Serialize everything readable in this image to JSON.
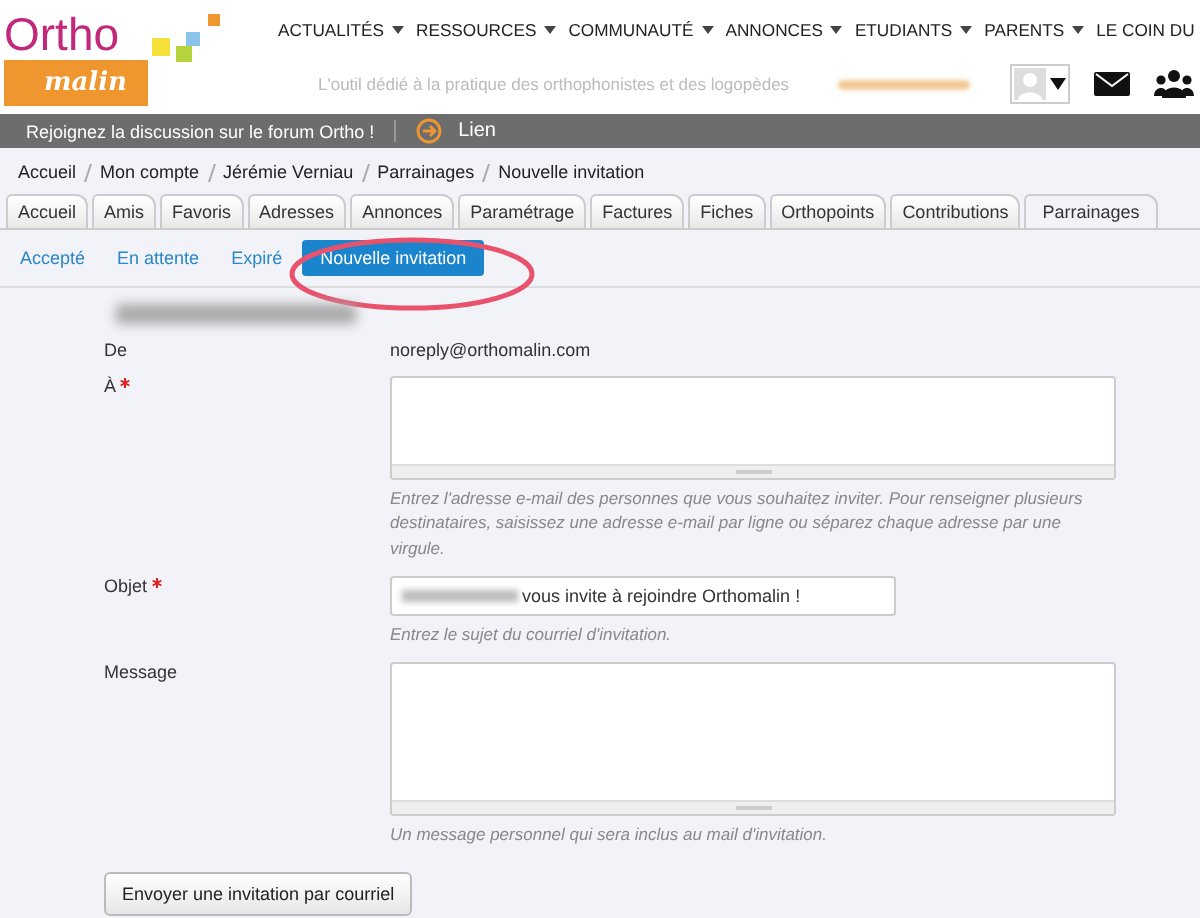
{
  "logo": {
    "top": "Ortho",
    "bottom": "malin"
  },
  "nav": [
    {
      "label": "ACTUALITÉS",
      "caret": true
    },
    {
      "label": "RESSOURCES",
      "caret": true
    },
    {
      "label": "COMMUNAUTÉ",
      "caret": true
    },
    {
      "label": "ANNONCES",
      "caret": true
    },
    {
      "label": "ETUDIANTS",
      "caret": true
    },
    {
      "label": "PARENTS",
      "caret": true
    },
    {
      "label": "LE COIN DU",
      "caret": false
    }
  ],
  "tagline": "L'outil dédié à la pratique des orthophonistes et des logopèdes",
  "banner": {
    "text": "Rejoignez la discussion sur le forum Ortho !",
    "link": "Lien"
  },
  "breadcrumb": [
    "Accueil",
    "Mon compte",
    "Jérémie Verniau",
    "Parrainages",
    "Nouvelle invitation"
  ],
  "tabs": [
    {
      "label": "Accueil",
      "selected": false
    },
    {
      "label": "Amis",
      "selected": false
    },
    {
      "label": "Favoris",
      "selected": false
    },
    {
      "label": "Adresses",
      "selected": false
    },
    {
      "label": "Annonces",
      "selected": false
    },
    {
      "label": "Paramétrage",
      "selected": false
    },
    {
      "label": "Factures",
      "selected": false
    },
    {
      "label": "Fiches",
      "selected": false
    },
    {
      "label": "Orthopoints",
      "selected": false
    },
    {
      "label": "Contributions",
      "selected": false
    },
    {
      "label": "Parrainages",
      "selected": true
    }
  ],
  "subtabs": [
    {
      "label": "Accepté",
      "selected": false
    },
    {
      "label": "En attente",
      "selected": false
    },
    {
      "label": "Expiré",
      "selected": false
    },
    {
      "label": "Nouvelle invitation",
      "selected": true
    }
  ],
  "form": {
    "from": {
      "label": "De",
      "value": "noreply@orthomalin.com"
    },
    "to": {
      "label": "À",
      "required": true,
      "help": "Entrez l'adresse e-mail des personnes que vous souhaitez inviter. Pour renseigner plusieurs destinataires, saisissez une adresse e-mail par ligne ou séparez chaque adresse par une virgule."
    },
    "subject": {
      "label": "Objet",
      "required": true,
      "value": "vous invite à rejoindre Orthomalin !",
      "help": "Entrez le sujet du courriel d'invitation."
    },
    "message": {
      "label": "Message",
      "required": false,
      "help": "Un message personnel qui sera inclus au mail d'invitation."
    },
    "submit": "Envoyer une invitation par courriel"
  }
}
